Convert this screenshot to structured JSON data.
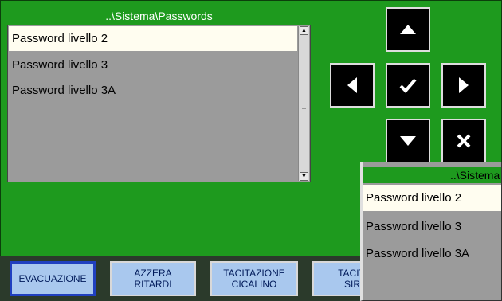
{
  "main_panel": {
    "title": "..\\Sistema\\Passwords",
    "items": [
      {
        "label": "Password livello 2",
        "selected": true
      },
      {
        "label": "Password livello 3",
        "selected": false
      },
      {
        "label": "Password livello 3A",
        "selected": false
      }
    ]
  },
  "nav": {
    "up_icon": "arrow-up-icon",
    "left_icon": "arrow-left-icon",
    "ok_icon": "checkmark-icon",
    "right_icon": "arrow-right-icon",
    "down_icon": "arrow-down-icon",
    "cancel_icon": "close-icon"
  },
  "popup": {
    "title": "..\\Sistema",
    "items": [
      {
        "label": "Password livello 2",
        "selected": true
      },
      {
        "label": "Password livello 3",
        "selected": false
      },
      {
        "label": "Password livello 3A",
        "selected": false
      }
    ]
  },
  "bottom_bar": {
    "evacuazione": "EVACUAZIONE",
    "azzera_ritardi": "AZZERA\nRITARDI",
    "tacitazione_cicalino": "TACITAZIONE\nCICALINO",
    "tacit_sirene": "TACIT.A\nSIRE"
  },
  "colors": {
    "screen_bg": "#1e9a1e",
    "list_bg": "#9b9b9b",
    "selected_bg": "#fffdf0",
    "button_bg": "#a9c8ee"
  }
}
